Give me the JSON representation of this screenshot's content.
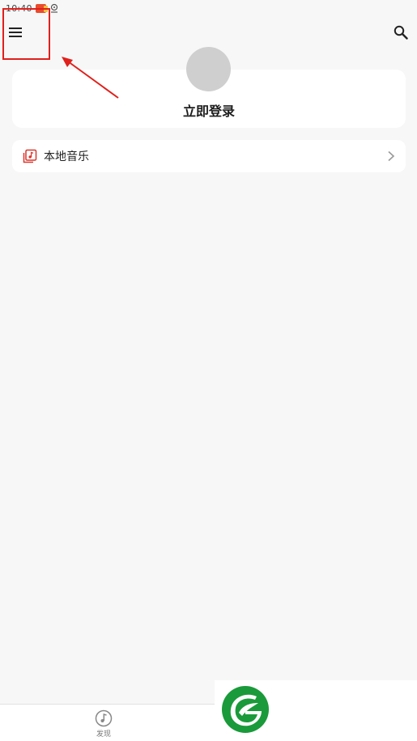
{
  "status_bar": {
    "time": "10:40"
  },
  "icons": {
    "menu": "menu-icon",
    "search": "search-icon",
    "local_music": "music-folder-icon",
    "chevron": "chevron-right-icon",
    "discover": "music-note-icon",
    "location": "location-icon"
  },
  "profile": {
    "login_label": "立即登录"
  },
  "local_music": {
    "label": "本地音乐"
  },
  "bottom_nav": {
    "discover_label": "发现"
  },
  "colors": {
    "background": "#f7f7f7",
    "card": "#ffffff",
    "accent": "#e0201b",
    "avatar": "#cfcfcf",
    "logo_green": "#1a9a3a"
  }
}
